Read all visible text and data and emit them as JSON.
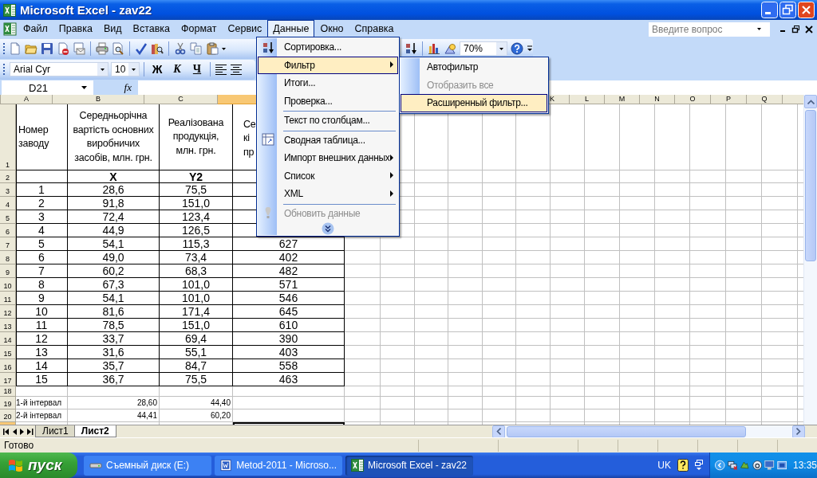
{
  "window": {
    "title": "Microsoft Excel - zav22"
  },
  "menu_bar": {
    "items": [
      {
        "label": "Файл",
        "selected": false
      },
      {
        "label": "Правка",
        "selected": false
      },
      {
        "label": "Вид",
        "selected": false
      },
      {
        "label": "Вставка",
        "selected": false
      },
      {
        "label": "Формат",
        "selected": false
      },
      {
        "label": "Сервис",
        "selected": false
      },
      {
        "label": "Данные",
        "selected": true
      },
      {
        "label": "Окно",
        "selected": false
      },
      {
        "label": "Справка",
        "selected": false
      }
    ]
  },
  "help_box": {
    "placeholder": "Введите вопрос"
  },
  "standard_toolbar": {
    "zoom": "70%"
  },
  "formatting_toolbar": {
    "font": "Arial Cyr",
    "size": "10",
    "buttons": [
      {
        "label": "Ж",
        "kind": "bold"
      },
      {
        "label": "К",
        "kind": "italic"
      },
      {
        "label": "Ч",
        "kind": "underline"
      }
    ]
  },
  "formula_bar": {
    "name_box": "D21",
    "function_label": "fx"
  },
  "sheet": {
    "columns": [
      {
        "label": "A",
        "selected": false
      },
      {
        "label": "B",
        "selected": false
      },
      {
        "label": "C",
        "selected": false
      },
      {
        "selected": true
      },
      {},
      {},
      {},
      {},
      {},
      {},
      {
        "label": "K",
        "selected": false
      },
      {
        "label": "L",
        "selected": false
      },
      {
        "label": "M",
        "selected": false
      },
      {
        "label": "N",
        "selected": false
      },
      {
        "label": "O",
        "selected": false
      },
      {
        "label": "P",
        "selected": false
      },
      {
        "label": "Q",
        "selected": false
      },
      {}
    ],
    "rows": [
      {
        "label": "1",
        "kind": "title",
        "selected": false,
        "cells": [
          "Номер заводу",
          "Середньорічна вартість основних виробничих засобів, млн. грн.",
          "Реалізована продукція, млн. грн.",
          "Се\nкі\nпр"
        ]
      },
      {
        "label": "2",
        "kind": "label",
        "selected": false,
        "cells": [
          null,
          "X",
          "Y2"
        ]
      },
      {
        "label": "3",
        "kind": "data",
        "selected": false,
        "cells": [
          "1",
          "28,6",
          "75,5"
        ]
      },
      {
        "label": "4",
        "kind": "data",
        "selected": false,
        "cells": [
          "2",
          "91,8",
          "151,0"
        ]
      },
      {
        "label": "5",
        "kind": "data",
        "selected": false,
        "cells": [
          "3",
          "72,4",
          "123,4"
        ]
      },
      {
        "label": "6",
        "kind": "data",
        "selected": false,
        "cells": [
          "4",
          "44,9",
          "126,5"
        ]
      },
      {
        "label": "7",
        "kind": "data",
        "selected": false,
        "cells": [
          "5",
          "54,1",
          "115,3",
          "627"
        ]
      },
      {
        "label": "8",
        "kind": "data",
        "selected": false,
        "cells": [
          "6",
          "49,0",
          "73,4",
          "402"
        ]
      },
      {
        "label": "9",
        "kind": "data",
        "selected": false,
        "cells": [
          "7",
          "60,2",
          "68,3",
          "482"
        ]
      },
      {
        "label": "10",
        "kind": "data",
        "selected": false,
        "cells": [
          "8",
          "67,3",
          "101,0",
          "571"
        ]
      },
      {
        "label": "11",
        "kind": "data",
        "selected": false,
        "cells": [
          "9",
          "54,1",
          "101,0",
          "546"
        ]
      },
      {
        "label": "12",
        "kind": "data",
        "selected": false,
        "cells": [
          "10",
          "81,6",
          "171,4",
          "645"
        ]
      },
      {
        "label": "13",
        "kind": "data",
        "selected": false,
        "cells": [
          "11",
          "78,5",
          "151,0",
          "610"
        ]
      },
      {
        "label": "14",
        "kind": "data",
        "selected": false,
        "cells": [
          "12",
          "33,7",
          "69,4",
          "390"
        ]
      },
      {
        "label": "15",
        "kind": "data",
        "selected": false,
        "cells": [
          "13",
          "31,6",
          "55,1",
          "403"
        ]
      },
      {
        "label": "16",
        "kind": "data",
        "selected": false,
        "cells": [
          "14",
          "35,7",
          "84,7",
          "558"
        ]
      },
      {
        "label": "17",
        "kind": "data",
        "selected": false,
        "cells": [
          "15",
          "36,7",
          "75,5",
          "463"
        ]
      },
      {
        "label": "18",
        "kind": "blank",
        "selected": false
      },
      {
        "label": "19",
        "kind": "small",
        "selected": false,
        "cells": [
          "1-й інтервал",
          "28,60",
          "44,40"
        ]
      },
      {
        "label": "20",
        "kind": "small",
        "selected": false,
        "cells": [
          "2-й інтервал",
          "44,41",
          "60,20"
        ]
      },
      {
        "kind": "blank",
        "selected": true
      }
    ]
  },
  "data_menu": {
    "items": [
      {
        "label": "Сортировка...",
        "selected": false,
        "disabled": false,
        "submenu": false,
        "separator_before": false
      },
      {
        "label": "Фильтр",
        "selected": true,
        "disabled": false,
        "submenu": true,
        "separator_before": false
      },
      {
        "label": "Итоги...",
        "selected": false,
        "disabled": false,
        "submenu": false,
        "separator_before": false
      },
      {
        "label": "Проверка...",
        "selected": false,
        "disabled": false,
        "submenu": false,
        "separator_before": false
      },
      {
        "label": "Текст по столбцам...",
        "selected": false,
        "disabled": false,
        "submenu": false,
        "separator_before": true
      },
      {
        "label": "Сводная таблица...",
        "selected": false,
        "disabled": false,
        "submenu": false,
        "separator_before": true
      },
      {
        "label": "Импорт внешних данных",
        "selected": false,
        "disabled": false,
        "submenu": true,
        "separator_before": false
      },
      {
        "label": "Список",
        "selected": false,
        "disabled": false,
        "submenu": true,
        "separator_before": false
      },
      {
        "label": "XML",
        "selected": false,
        "disabled": false,
        "submenu": true,
        "separator_before": false
      },
      {
        "label": "Обновить данные",
        "selected": false,
        "disabled": true,
        "submenu": false,
        "separator_before": true
      }
    ]
  },
  "filter_submenu": {
    "items": [
      {
        "label": "Автофильтр",
        "selected": false,
        "disabled": false
      },
      {
        "label": "Отобразить все",
        "selected": false,
        "disabled": true
      },
      {
        "label": "Расширенный фильтр...",
        "selected": true,
        "disabled": false
      }
    ]
  },
  "sheet_tabs": [
    {
      "label": "Лист1",
      "selected": false
    },
    {
      "label": "Лист2",
      "selected": true
    }
  ],
  "status_bar": {
    "text": "Готово"
  },
  "taskbar": {
    "start": "пуск",
    "tasks": [
      {
        "label": "Съемный диск (E:)",
        "kind": "drive",
        "selected": false
      },
      {
        "label": "Metod-2011 - Microso...",
        "kind": "document",
        "selected": false
      },
      {
        "label": "Microsoft Excel - zav22",
        "kind": "spreadsheet",
        "selected": true
      }
    ],
    "language": "UK",
    "clock": "13:35"
  }
}
